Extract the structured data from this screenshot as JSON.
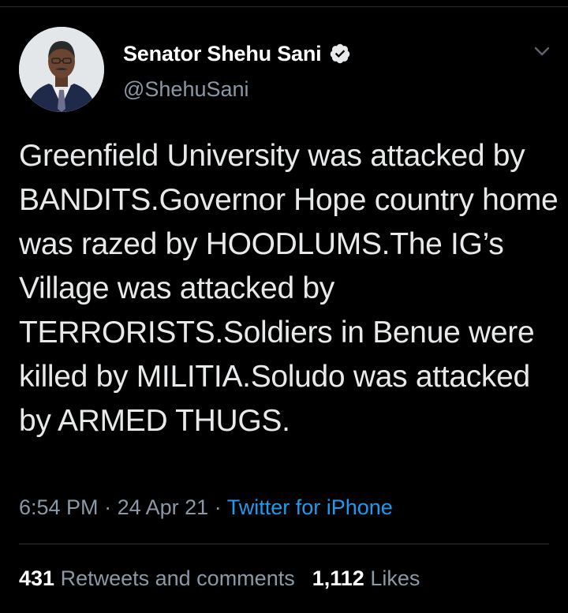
{
  "tweet": {
    "author": {
      "display_name": "Senator Shehu Sani",
      "handle": "@ShehuSani",
      "verified": true
    },
    "text": "Greenfield University was attacked by BANDITS.Governor Hope country home was razed by HOODLUMS.The IG’s Village was attacked by TERRORISTS.Soldiers in Benue were killed by MILITIA.Soludo was attacked by ARMED THUGS.",
    "time": "6:54 PM",
    "separator": "·",
    "date": "24 Apr 21",
    "source": "Twitter for iPhone",
    "retweets_count": "431",
    "retweets_label": "Retweets and comments",
    "likes_count": "1,112",
    "likes_label": "Likes"
  },
  "icons": {
    "verified": "verified-badge-icon",
    "menu": "chevron-down-icon",
    "avatar": "profile-avatar"
  },
  "colors": {
    "background": "#000000",
    "text": "#e7e9ea",
    "secondary": "#8b98a5",
    "link": "#1d9bf0",
    "divider": "#2f3336"
  }
}
